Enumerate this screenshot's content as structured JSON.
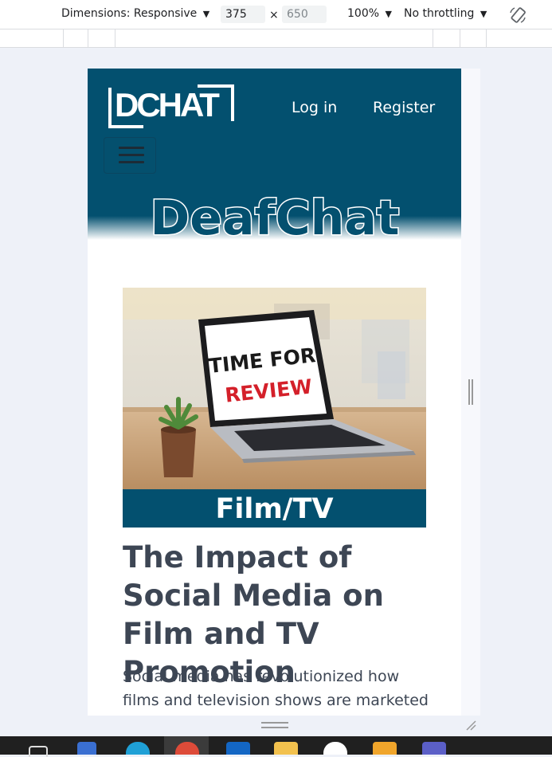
{
  "devtools_bar": {
    "dimensions_label": "Dimensions: Responsive",
    "width_value": "375",
    "times": "×",
    "height_placeholder": "650",
    "zoom": "100%",
    "throttling": "No throttling",
    "caret": "▼"
  },
  "site": {
    "logo_text": "DCHAT",
    "nav": {
      "login": "Log in",
      "register": "Register"
    },
    "brand_name": "DeafChat",
    "colors": {
      "primary": "#03506f",
      "text": "#3d4654"
    }
  },
  "article": {
    "image": {
      "line1": "TIME FOR",
      "line2": "REVIEW"
    },
    "category": "Film/TV",
    "title": "The Impact of Social Media on Film and TV Promotion",
    "excerpt": "Social media has revolutionized how films and television shows are marketed"
  },
  "taskbar": {
    "icons": [
      "file-explorer-icon",
      "settings-icon",
      "edge-icon",
      "chrome-icon",
      "outlook-icon",
      "folder-icon",
      "whatsapp-icon",
      "app-icon",
      "teams-icon"
    ]
  }
}
